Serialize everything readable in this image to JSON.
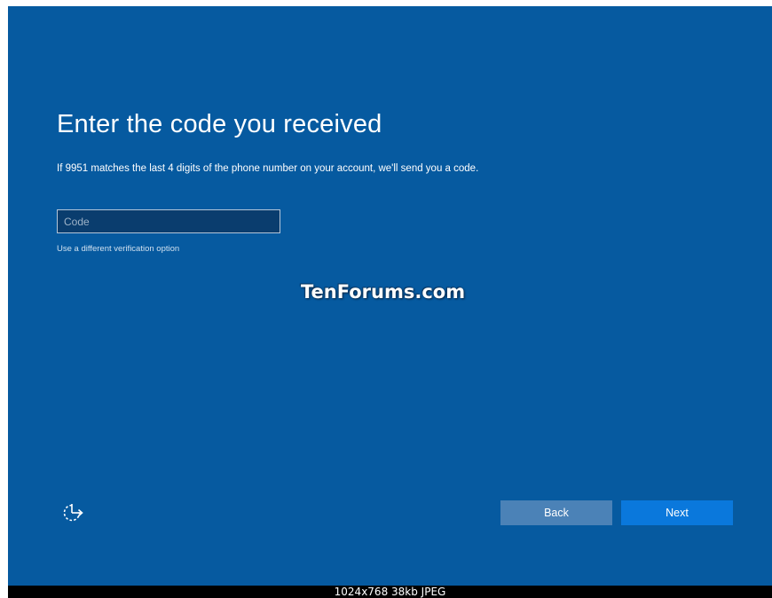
{
  "screen": {
    "title": "Enter the code you received",
    "description": "If 9951 matches the last 4 digits of the phone number on your account, we'll send you a code.",
    "code_input": {
      "value": "",
      "placeholder": "Code"
    },
    "alt_verification_link": "Use a different verification option",
    "watermark": "TenForums.com",
    "accessibility_icon": "ease-of-access-icon",
    "buttons": {
      "back_label": "Back",
      "next_label": "Next"
    }
  },
  "image_info": "1024x768  38kb  JPEG",
  "colors": {
    "background": "#065aa0",
    "back_button": "#4b82b7",
    "next_button": "#0a78dc"
  }
}
